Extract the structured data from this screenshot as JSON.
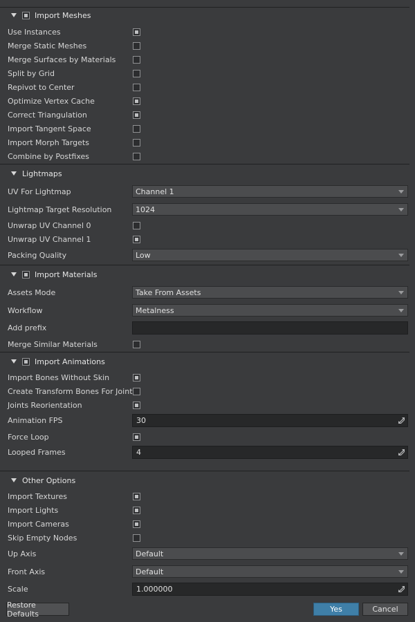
{
  "sections": {
    "meshes": {
      "title": "Import Meshes",
      "checked": true,
      "items": [
        {
          "label": "Use Instances",
          "checked": true
        },
        {
          "label": "Merge Static Meshes",
          "checked": false
        },
        {
          "label": "Merge Surfaces by Materials",
          "checked": false
        },
        {
          "label": "Split by Grid",
          "checked": false
        },
        {
          "label": "Repivot to Center",
          "checked": false
        },
        {
          "label": "Optimize Vertex Cache",
          "checked": true
        },
        {
          "label": "Correct Triangulation",
          "checked": true
        },
        {
          "label": "Import Tangent Space",
          "checked": false
        },
        {
          "label": "Import Morph Targets",
          "checked": false
        },
        {
          "label": "Combine by Postfixes",
          "checked": false
        }
      ]
    },
    "lightmaps": {
      "title": "Lightmaps",
      "uv_label": "UV For Lightmap",
      "uv_value": "Channel 1",
      "res_label": "Lightmap Target Resolution",
      "res_value": "1024",
      "unwrap0_label": "Unwrap UV Channel 0",
      "unwrap0_checked": false,
      "unwrap1_label": "Unwrap UV Channel 1",
      "unwrap1_checked": true,
      "quality_label": "Packing Quality",
      "quality_value": "Low"
    },
    "materials": {
      "title": "Import Materials",
      "checked": true,
      "assets_label": "Assets Mode",
      "assets_value": "Take From Assets",
      "workflow_label": "Workflow",
      "workflow_value": "Metalness",
      "prefix_label": "Add prefix",
      "prefix_value": "",
      "merge_label": "Merge Similar Materials",
      "merge_checked": false
    },
    "animations": {
      "title": "Import Animations",
      "checked": true,
      "bones_label": "Import Bones Without Skin",
      "bones_checked": true,
      "transform_label": "Create Transform Bones For Joints",
      "transform_checked": false,
      "joints_label": "Joints Reorientation",
      "joints_checked": true,
      "fps_label": "Animation FPS",
      "fps_value": "30",
      "loop_label": "Force Loop",
      "loop_checked": true,
      "frames_label": "Looped Frames",
      "frames_value": "4"
    },
    "other": {
      "title": "Other Options",
      "textures_label": "Import Textures",
      "textures_checked": true,
      "lights_label": "Import Lights",
      "lights_checked": true,
      "cameras_label": "Import Cameras",
      "cameras_checked": true,
      "skip_label": "Skip Empty Nodes",
      "skip_checked": false,
      "up_label": "Up Axis",
      "up_value": "Default",
      "front_label": "Front Axis",
      "front_value": "Default",
      "scale_label": "Scale",
      "scale_value": "1.000000"
    }
  },
  "buttons": {
    "restore": "Restore Defaults",
    "yes": "Yes",
    "cancel": "Cancel"
  },
  "colors": {
    "background": "#3a3b3d",
    "primary_button": "#3f7fa8"
  }
}
